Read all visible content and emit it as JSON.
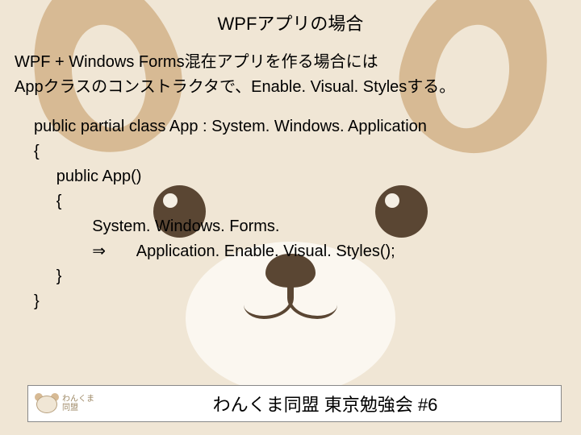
{
  "slide": {
    "title": "WPFアプリの場合",
    "paragraph_line1": "WPF + Windows Forms混在アプリを作る場合には",
    "paragraph_line2": "Appクラスのコンストラクタで、Enable. Visual. Stylesする。",
    "code": {
      "l1": "public partial class App : System. Windows. Application",
      "l2": "{",
      "l3": "     public App()",
      "l4": "     {",
      "l5": "             System. Windows. Forms.",
      "l6": "             ⇒       Application. Enable. Visual. Styles();",
      "l7": "     }",
      "l8": "}"
    }
  },
  "footer": {
    "logo_line1": "わんくま",
    "logo_line2": "同盟",
    "text": "わんくま同盟 東京勉強会 #6"
  }
}
